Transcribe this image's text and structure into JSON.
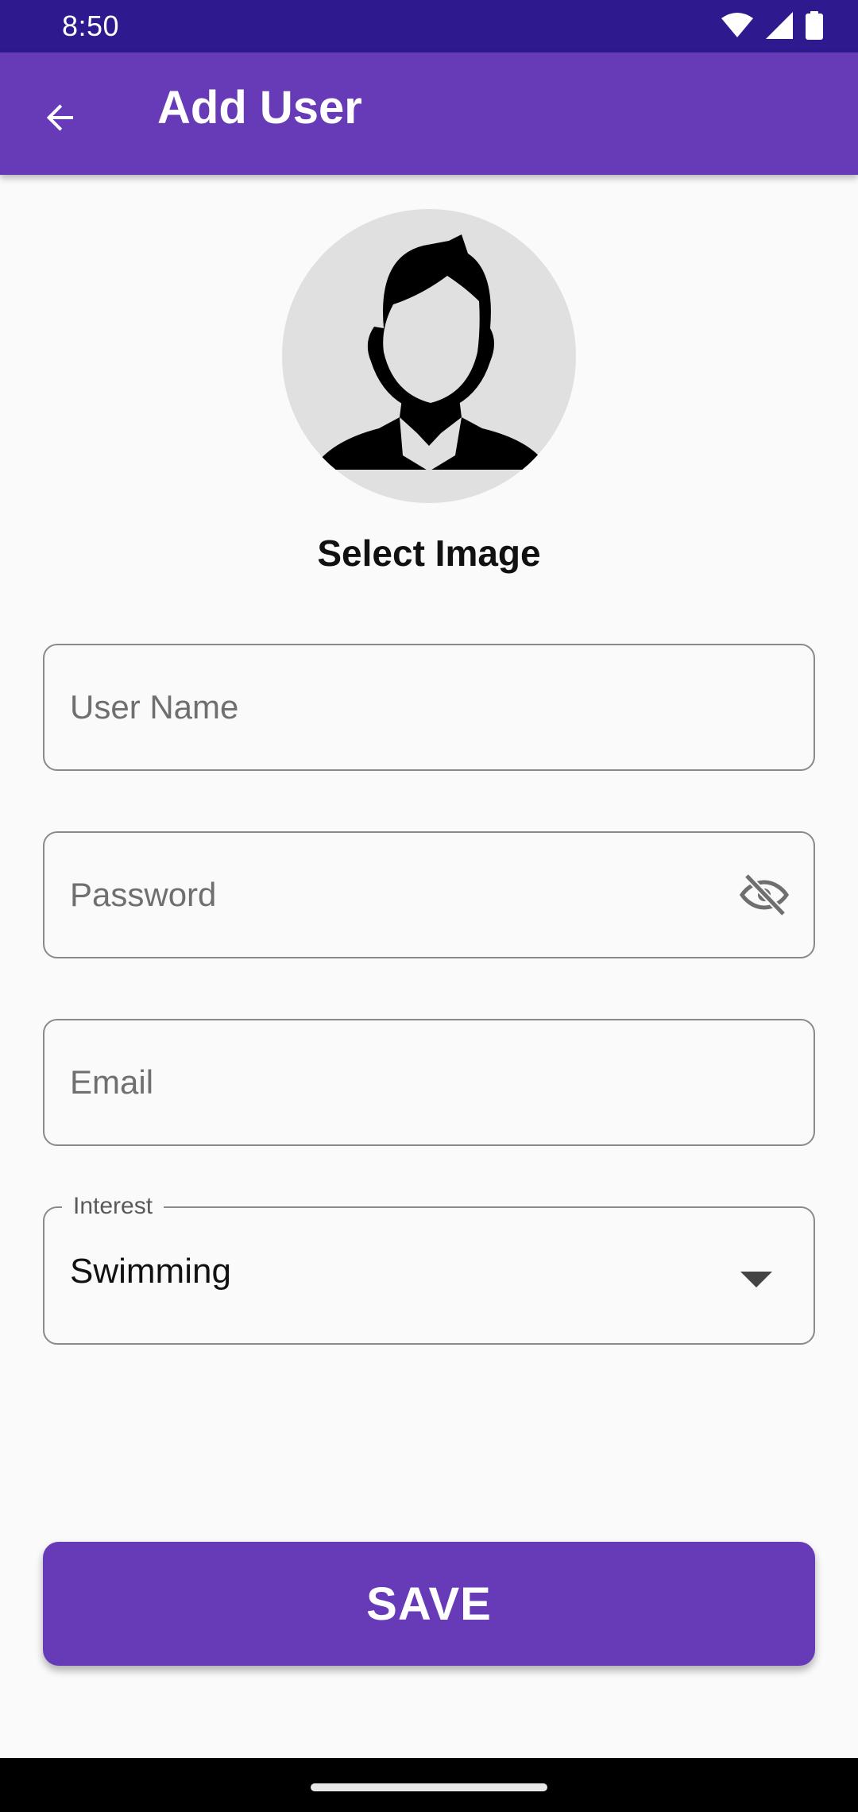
{
  "status_bar": {
    "time": "8:50",
    "icons": [
      "wifi-icon",
      "cellular-signal-icon",
      "battery-icon"
    ]
  },
  "app_bar": {
    "title": "Add User",
    "back_icon": "arrow-back-icon",
    "color": "#673ab7"
  },
  "profile": {
    "avatar_icon": "person-placeholder-icon",
    "select_image_label": "Select Image"
  },
  "form": {
    "username": {
      "value": "",
      "placeholder": "User Name"
    },
    "password": {
      "value": "",
      "placeholder": "Password",
      "visibility_icon": "visibility-off-icon"
    },
    "email": {
      "value": "",
      "placeholder": "Email"
    },
    "interest": {
      "label": "Interest",
      "selected": "Swimming",
      "icon": "arrow-drop-down-icon"
    }
  },
  "actions": {
    "save_label": "SAVE"
  },
  "colors": {
    "primary": "#673ab7",
    "status_bar": "#2e1a8e",
    "background": "#fafafa"
  }
}
